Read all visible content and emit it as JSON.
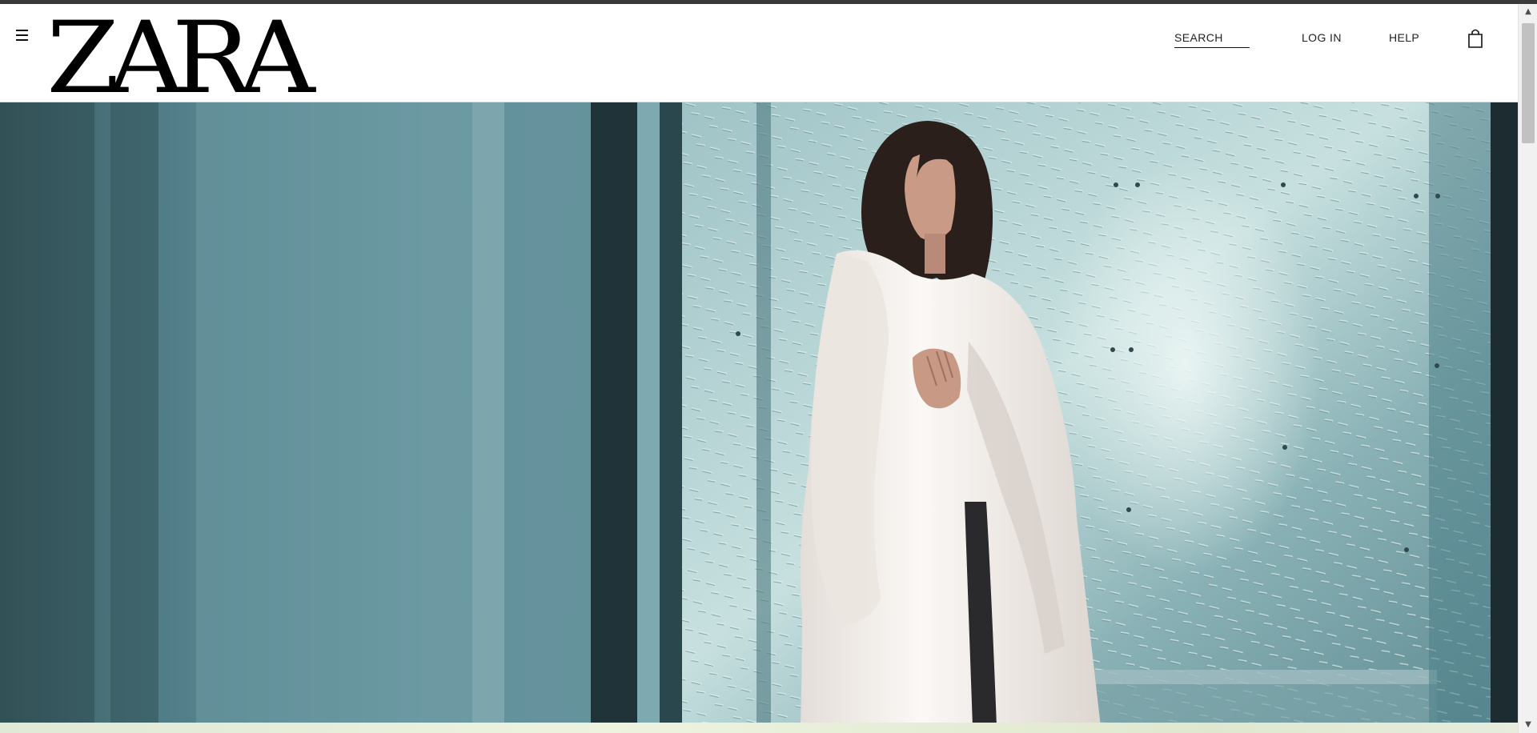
{
  "brand": {
    "logo_text": "ZARA"
  },
  "header": {
    "menu_icon": "hamburger-icon",
    "search_label": "SEARCH",
    "login_label": "LOG IN",
    "help_label": "HELP",
    "bag_icon": "shopping-bag-icon"
  },
  "hero": {
    "image_description_icon": "campaign-photo"
  },
  "scrollbar": {
    "up_glyph": "▲",
    "down_glyph": "▼"
  },
  "colors": {
    "header_bg": "#ffffff",
    "text": "#111111",
    "hero_teal": "#5b8f98",
    "coat_white": "#f2eeea"
  }
}
